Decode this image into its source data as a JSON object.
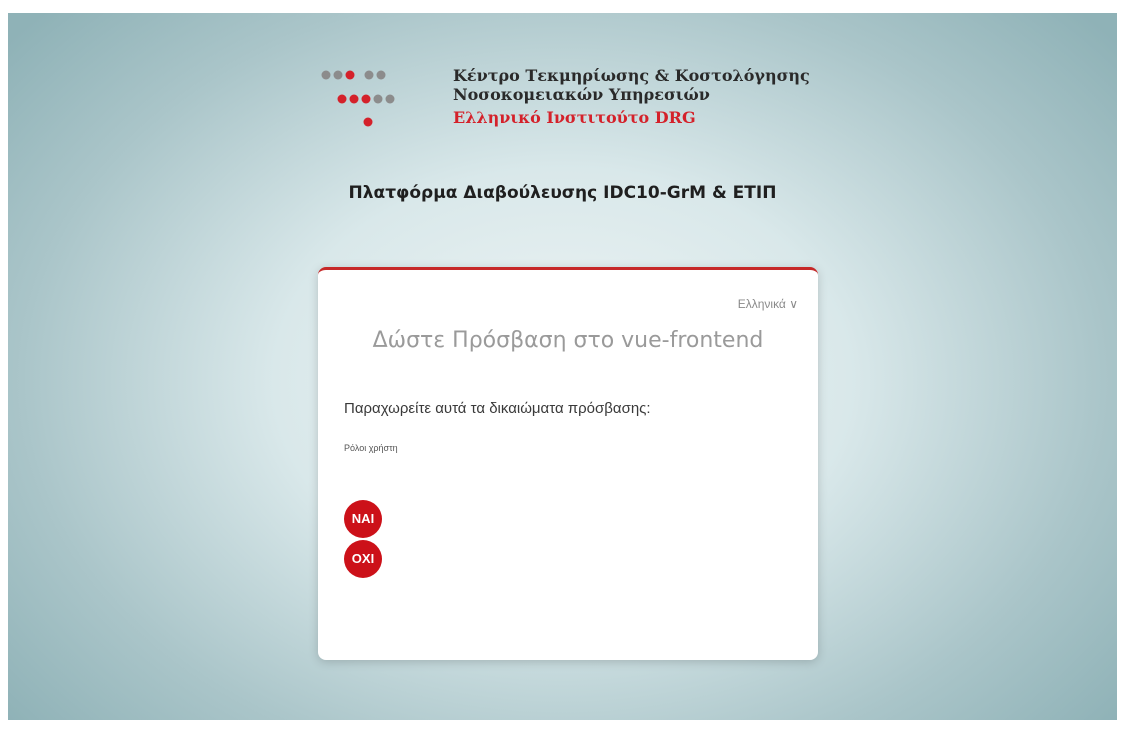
{
  "header": {
    "org_line1": "Κέντρο Τεκμηρίωσης & Κοστολόγησης",
    "org_line2": "Νοσοκομειακών Υπηρεσιών",
    "org_line3": "Ελληνικό Ινστιτούτο DRG",
    "platform_title": "Πλατφόρμα Διαβούλευσης IDC10-GrM & ΕΤΙΠ"
  },
  "card": {
    "language": "Ελληνικά ∨",
    "title": "Δώστε Πρόσβαση στο vue-frontend",
    "grant_text": "Παραχωρείτε αυτά τα δικαιώματα πρόσβασης:",
    "roles_label": "Ρόλοι χρήστη",
    "yes_label": "ΝΑΙ",
    "no_label": "ΟΧΙ"
  },
  "colors": {
    "accent_red": "#cc1119",
    "logo_grey": "#8c8c8c",
    "logo_red": "#d4212a"
  }
}
